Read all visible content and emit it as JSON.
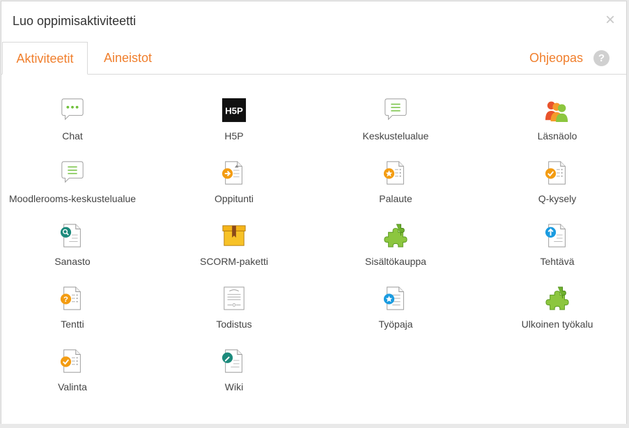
{
  "dialog": {
    "title": "Luo oppimisaktiviteetti",
    "close_label": "×"
  },
  "tabs": [
    {
      "label": "Aktiviteetit",
      "active": true
    },
    {
      "label": "Aineistot",
      "active": false
    }
  ],
  "help": {
    "label": "Ohjeopas",
    "icon_label": "?"
  },
  "activities": [
    {
      "label": "Chat",
      "icon": "chat-icon"
    },
    {
      "label": "H5P",
      "icon": "h5p-icon"
    },
    {
      "label": "Keskustelualue",
      "icon": "forum-icon"
    },
    {
      "label": "Läsnäolo",
      "icon": "attendance-icon"
    },
    {
      "label": "Moodlerooms-keskustelualue",
      "icon": "forum-icon"
    },
    {
      "label": "Oppitunti",
      "icon": "lesson-icon"
    },
    {
      "label": "Palaute",
      "icon": "feedback-icon"
    },
    {
      "label": "Q-kysely",
      "icon": "questionnaire-icon"
    },
    {
      "label": "Sanasto",
      "icon": "glossary-icon"
    },
    {
      "label": "SCORM-paketti",
      "icon": "scorm-package-icon"
    },
    {
      "label": "Sisältökauppa",
      "icon": "puzzle-icon"
    },
    {
      "label": "Tehtävä",
      "icon": "assignment-icon"
    },
    {
      "label": "Tentti",
      "icon": "quiz-icon"
    },
    {
      "label": "Todistus",
      "icon": "certificate-icon"
    },
    {
      "label": "Työpaja",
      "icon": "workshop-icon"
    },
    {
      "label": "Ulkoinen työkalu",
      "icon": "puzzle-icon"
    },
    {
      "label": "Valinta",
      "icon": "choice-icon"
    },
    {
      "label": "Wiki",
      "icon": "wiki-icon"
    }
  ],
  "colors": {
    "accent": "#f07f2d",
    "green": "#6fbf3a",
    "blue": "#1a9be0",
    "teal": "#1c8a7c"
  }
}
